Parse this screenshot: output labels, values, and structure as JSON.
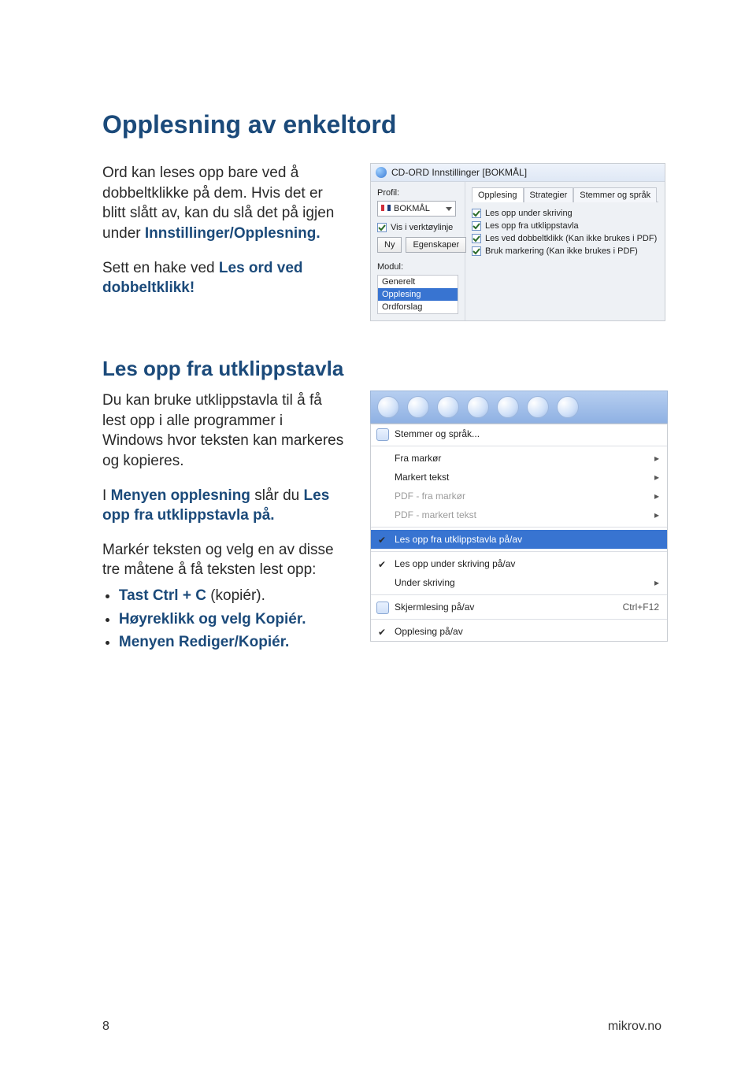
{
  "headings": {
    "h1": "Opplesning av enkeltord",
    "h2": "Les opp fra utklippstavla"
  },
  "para": {
    "p1a": "Ord kan leses opp bare ved å dobbeltklikke på dem. Hvis det er blitt slått av, kan du slå det på igjen under ",
    "p1em": "Innstillinger/Opplesning.",
    "p2a": "Sett en hake ved ",
    "p2em": "Les ord ved dobbeltklikk!",
    "p3": "Du kan bruke utklippstavla til å få lest opp i alle programmer i Windows hvor teksten kan markeres og kopieres.",
    "p4a": "I ",
    "p4em1": "Menyen opplesning",
    "p4b": " slår du ",
    "p4em2": "Les opp fra utklipps­tavla på.",
    "p5": "Markér teksten og velg en av disse tre måtene å få teksten lest opp:"
  },
  "bullets": {
    "b1em": "Tast Ctrl + C",
    "b1rest": " (kopiér).",
    "b2em": "Høyreklikk og velg Kopiér.",
    "b3em": "Menyen Rediger/Kopiér."
  },
  "shotA": {
    "title": "CD-ORD Innstillinger [BOKMÅL]",
    "profilLabel": "Profil:",
    "profilValue": "BOKMÅL",
    "visChk": "Vis i verktøylinje",
    "nyBtn": "Ny",
    "egBtn": "Egenskaper",
    "modulLabel": "Modul:",
    "mod1": "Generelt",
    "mod2": "Opplesing",
    "mod3": "Ordforslag",
    "tab1": "Opplesing",
    "tab2": "Strategier",
    "tab3": "Stemmer og språk",
    "c1": "Les opp under skriving",
    "c2": "Les opp fra utklippstavla",
    "c3": "Les ved dobbeltklikk (Kan ikke brukes i PDF)",
    "c4": "Bruk markering (Kan ikke brukes i PDF)"
  },
  "shotB": {
    "m_head": "Stemmer og språk...",
    "m_fra": "Fra markør",
    "m_markert": "Markert tekst",
    "m_pdf_fra": "PDF - fra markør",
    "m_pdf_mark": "PDF - markert tekst",
    "m_utklipp": "Les opp fra utklippstavla på/av",
    "m_skriving": "Les opp under skriving på/av",
    "m_under": "Under skriving",
    "m_skjerm": "Skjermlesing på/av",
    "m_skjerm_sc": "Ctrl+F12",
    "m_oppl": "Opplesing på/av"
  },
  "footer": {
    "page": "8",
    "url": "mikrov.no"
  }
}
